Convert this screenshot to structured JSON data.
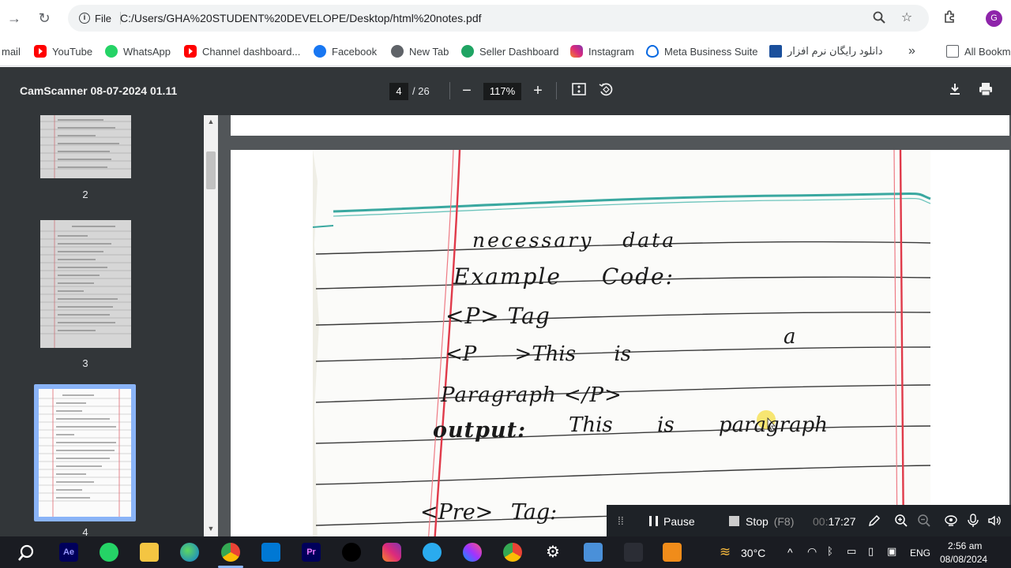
{
  "browser": {
    "file_label": "File",
    "url": "C:/Users/GHA%20STUDENT%20DEVELOPE/Desktop/html%20notes.pdf",
    "profile_initial": "G"
  },
  "bookmarks": {
    "items": [
      {
        "label": "mail",
        "icon": "gmail-icon"
      },
      {
        "label": "YouTube",
        "icon": "youtube-icon"
      },
      {
        "label": "WhatsApp",
        "icon": "whatsapp-icon"
      },
      {
        "label": "Channel dashboard...",
        "icon": "youtube-icon"
      },
      {
        "label": "Facebook",
        "icon": "facebook-icon"
      },
      {
        "label": "New Tab",
        "icon": "newtab-icon"
      },
      {
        "label": "Seller Dashboard",
        "icon": "seller-icon"
      },
      {
        "label": "Instagram",
        "icon": "instagram-icon"
      },
      {
        "label": "Meta Business Suite",
        "icon": "meta-icon"
      },
      {
        "label": "دانلود رایگان نرم افزار",
        "icon": "download-site-icon"
      }
    ],
    "overflow": "»",
    "all_bookmarks": "All Bookm"
  },
  "pdf": {
    "title": "CamScanner 08-07-2024 01.11",
    "current_page": "4",
    "total_pages": "/ 26",
    "zoom": "117%",
    "thumbnails": [
      "2",
      "3",
      "4"
    ],
    "handwriting": {
      "line1": "necessary data",
      "line2": "Example Code:",
      "line3": "<P> Tag",
      "line4a": "<P >This is",
      "line4b": "a",
      "line5": "Paragraph </P>",
      "line6a": "output:",
      "line6b": "This is paragraph",
      "line7": "<Pre> Tag:"
    }
  },
  "recorder": {
    "pause": "Pause",
    "stop": "Stop",
    "stop_key": "(F8)",
    "elapsed_dim": "00:",
    "elapsed": "17:27"
  },
  "taskbar": {
    "weather": "30°C",
    "language": "ENG",
    "time": "2:56 am",
    "date": "08/08/2024"
  },
  "colors": {
    "pdf_toolbar": "#323639",
    "pdf_background": "#525659",
    "taskbar": "#1a1c22",
    "margin_red": "#e03a4a",
    "ruled_line": "#3a3a3a",
    "top_line_teal": "#3aa8a0"
  }
}
